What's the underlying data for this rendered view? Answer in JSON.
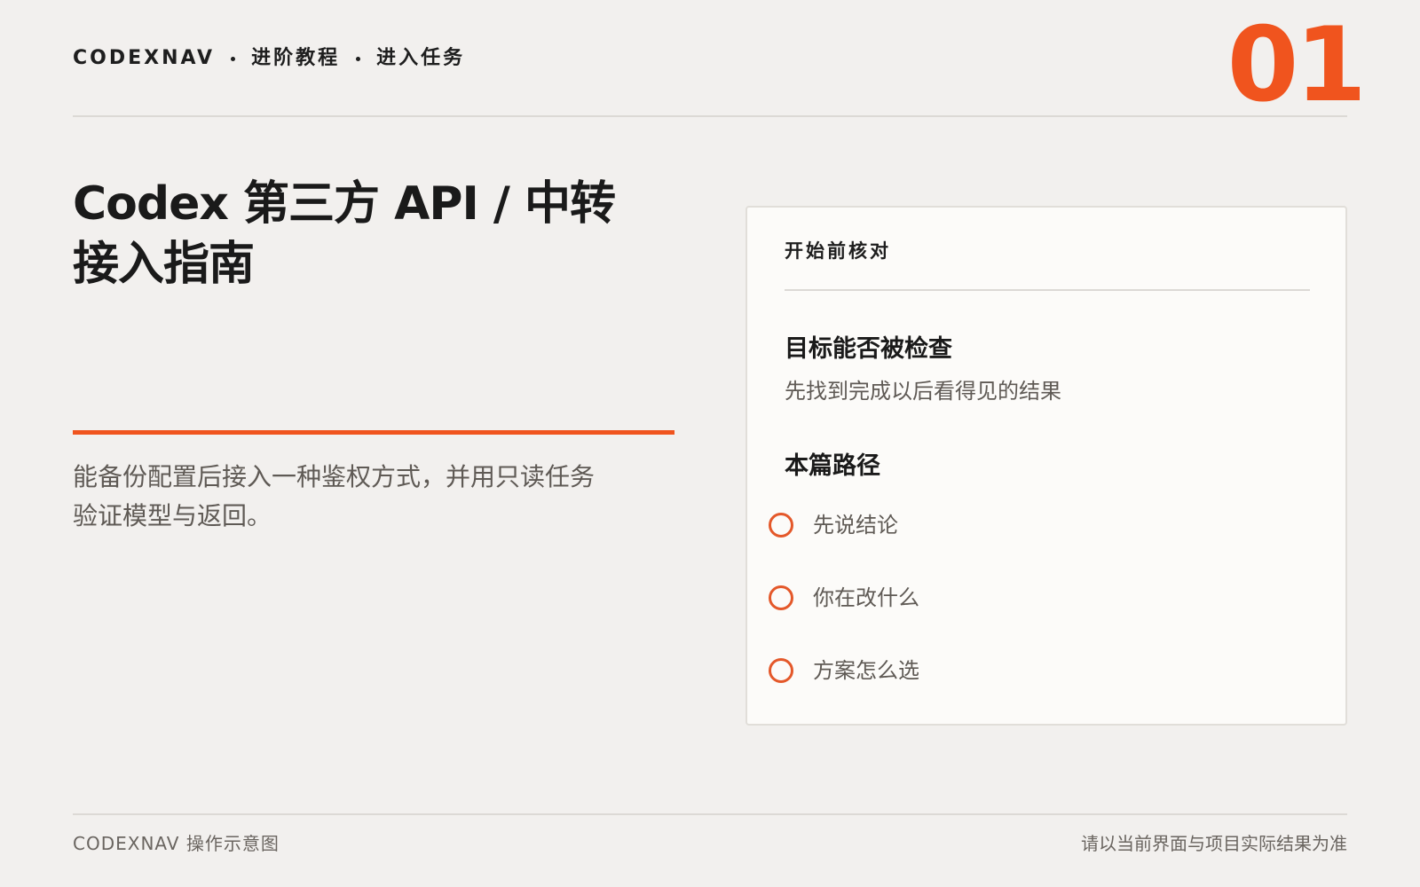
{
  "header": {
    "brand": "CODEXNAV",
    "crumbs": [
      "进阶教程",
      "进入任务"
    ],
    "page_number": "01"
  },
  "main": {
    "title_line1": "Codex 第三方 API / 中转",
    "title_line2": "接入指南",
    "description_line1": "能备份配置后接入一种鉴权方式，并用只读任务",
    "description_line2": "验证模型与返回。"
  },
  "card": {
    "header": "开始前核对",
    "goal_title": "目标能否被检查",
    "goal_desc": "先找到完成以后看得见的结果",
    "path_title": "本篇路径",
    "path_items": [
      {
        "label": "先说结论"
      },
      {
        "label": "你在改什么"
      },
      {
        "label": "方案怎么选"
      }
    ]
  },
  "footer": {
    "left": "CODEXNAV 操作示意图",
    "right": "请以当前界面与项目实际结果为准"
  },
  "colors": {
    "accent": "#f0541e",
    "background": "#f2f0ee",
    "card_background": "#fcfbf9",
    "text_primary": "#1a1a1a",
    "text_secondary": "#5f5a55"
  }
}
